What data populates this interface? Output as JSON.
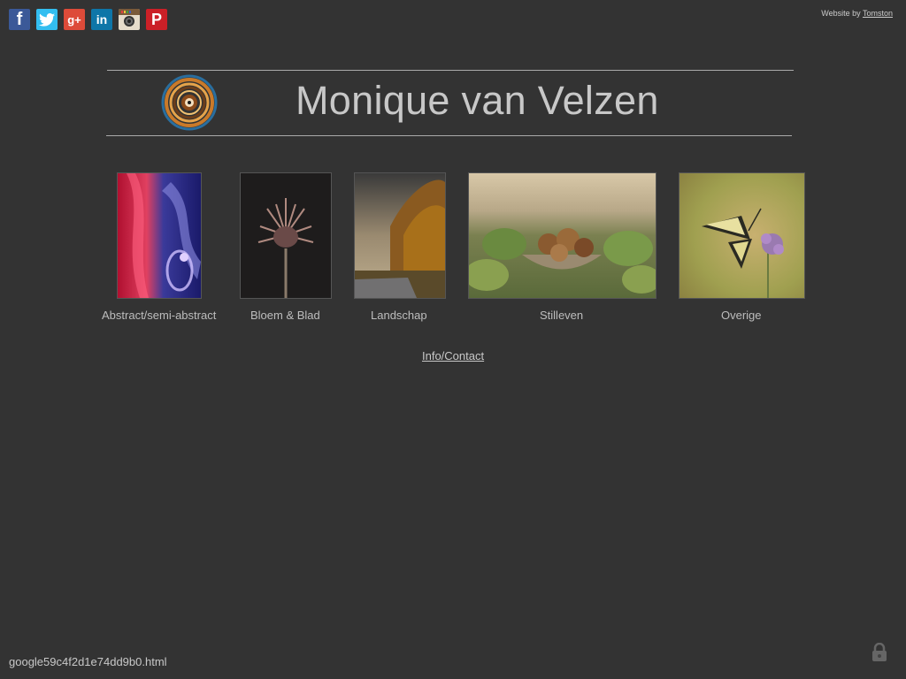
{
  "social": {
    "facebook": {
      "glyph": "f",
      "icon": "facebook-icon"
    },
    "twitter": {
      "icon": "twitter-icon"
    },
    "googleplus": {
      "glyph": "g+",
      "icon": "google-plus-icon"
    },
    "linkedin": {
      "glyph": "in",
      "icon": "linkedin-icon"
    },
    "instagram": {
      "icon": "instagram-icon"
    },
    "pinterest": {
      "glyph": "P",
      "icon": "pinterest-icon"
    }
  },
  "credit": {
    "prefix": "Website by",
    "link": "Tomston"
  },
  "header": {
    "title": "Monique van Velzen"
  },
  "gallery": [
    {
      "caption": "Abstract/semi-abstract"
    },
    {
      "caption": "Bloem & Blad"
    },
    {
      "caption": "Landschap"
    },
    {
      "caption": "Stilleven"
    },
    {
      "caption": "Overige"
    }
  ],
  "nav": {
    "contact": "Info/Contact"
  },
  "footer": {
    "filename": "google59c4f2d1e74dd9b0.html"
  },
  "colors": {
    "background": "#333333",
    "title": "#c8c8c8",
    "caption": "#bdbdbd"
  }
}
